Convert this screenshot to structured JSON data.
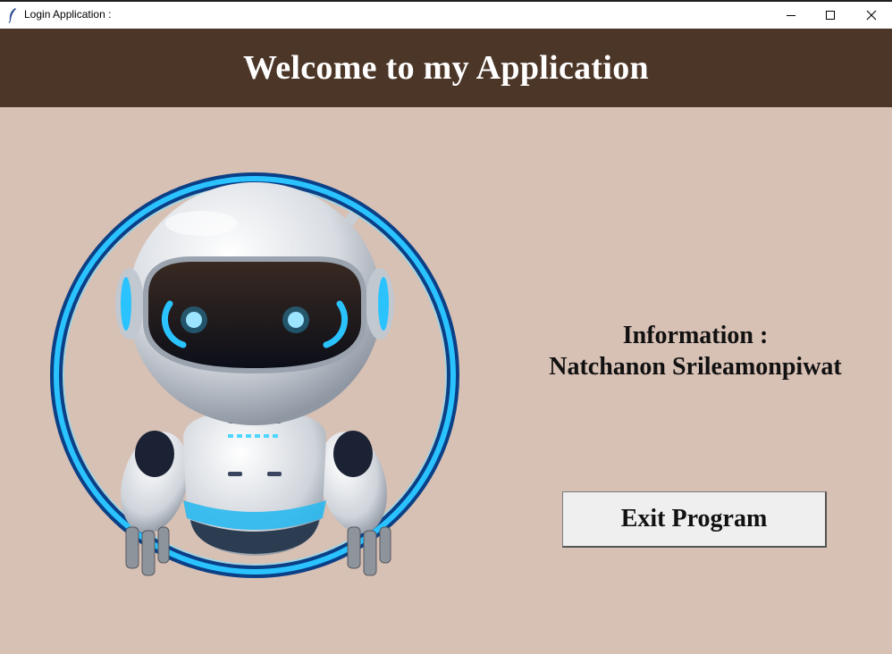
{
  "window": {
    "title": "Login Application :",
    "controls": [
      "minimize-icon",
      "maximize-icon",
      "close-icon"
    ]
  },
  "header": {
    "title": "Welcome to my Application"
  },
  "image": {
    "subject": "robot-mascot-icon"
  },
  "info": {
    "line1": "Information :",
    "line2": "Natchanon Srileamonpiwat"
  },
  "actions": {
    "exit_label": "Exit Program"
  },
  "colors": {
    "header_bg": "#4c3628",
    "body_bg": "#d7c0b4",
    "button_bg": "#efefef",
    "ring": "#1fb8f0"
  }
}
